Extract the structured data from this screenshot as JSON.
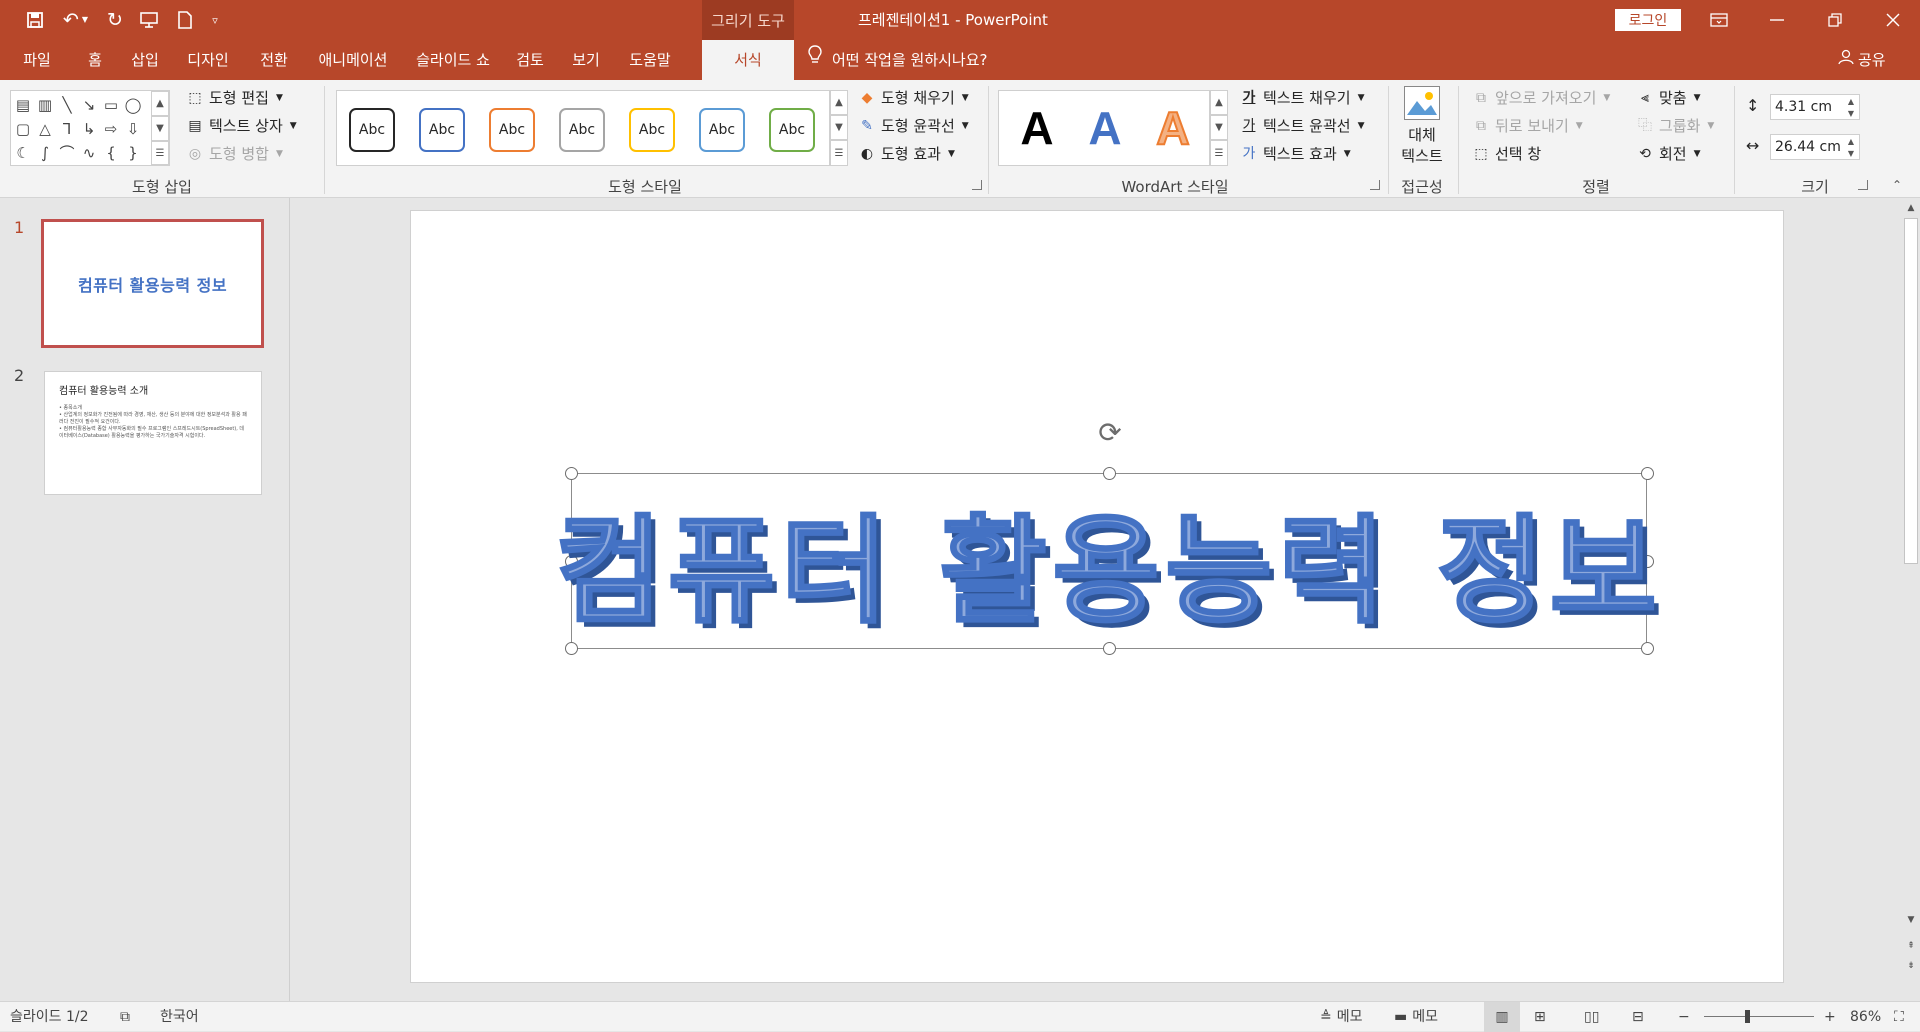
{
  "title_bar": {
    "context_tool": "그리기 도구",
    "document_title": "프레젠테이션1  -  PowerPoint",
    "login_label": "로그인",
    "quick_access_icons": [
      "save-icon",
      "undo-icon",
      "redo-icon",
      "present-icon",
      "new-file-icon",
      "customize-icon"
    ]
  },
  "tabs": [
    {
      "label": "파일"
    },
    {
      "label": "홈"
    },
    {
      "label": "삽입"
    },
    {
      "label": "디자인"
    },
    {
      "label": "전환"
    },
    {
      "label": "애니메이션"
    },
    {
      "label": "슬라이드 쇼"
    },
    {
      "label": "검토"
    },
    {
      "label": "보기"
    },
    {
      "label": "도움말"
    },
    {
      "label": "서식",
      "active": true
    }
  ],
  "tell_me": "어떤 작업을 원하시나요?",
  "share_label": "공유",
  "ribbon": {
    "insert_shapes": {
      "label": "도형 삽입",
      "edit_shape": "도형 편집",
      "text_box": "텍스트 상자",
      "merge_shapes": "도형 병합"
    },
    "shape_styles": {
      "label": "도형 스타일",
      "swatch_text": "Abc",
      "swatch_colors": [
        "#262626",
        "#4472c4",
        "#ed7d31",
        "#a5a5a5",
        "#ffc000",
        "#5b9bd5",
        "#70ad47"
      ],
      "fill": "도형 채우기",
      "outline": "도형 윤곽선",
      "effects": "도형 효과"
    },
    "wordart_styles": {
      "label": "WordArt 스타일",
      "letter": "A",
      "text_fill": "텍스트 채우기",
      "text_outline": "텍스트 윤곽선",
      "text_effects": "텍스트 효과"
    },
    "accessibility": {
      "label": "접근성",
      "alt_text_line1": "대체",
      "alt_text_line2": "텍스트"
    },
    "arrange": {
      "label": "정렬",
      "bring_forward": "앞으로 가져오기",
      "send_backward": "뒤로 보내기",
      "selection_pane": "선택 창",
      "align": "맞춤",
      "group": "그룹화",
      "rotate": "회전"
    },
    "size": {
      "label": "크기",
      "height": "4.31 cm",
      "width": "26.44 cm"
    }
  },
  "slides": [
    {
      "number": "1",
      "title": "컴퓨터 활용능력 정보"
    },
    {
      "number": "2",
      "title": "컴퓨터 활용능력 소개",
      "bullets": [
        "• 종목소개",
        "• 산업계의 정보화가 진전됨에 따라 경영, 재산, 생산 등의 분야에 대한 정보분석과 활용 패러다 전진이 필수적 요건이다.",
        "• 컴퓨터활용능력 종합 사무자동화의 필수 프로그램인 스프레드시트(SpreadSheet), 데이터베이스(Database) 활용능력을 평가하는 국가기술자격 시험이다."
      ]
    }
  ],
  "slide_canvas": {
    "title": "컴퓨터 활용능력 정보"
  },
  "status_bar": {
    "slide_indicator": "슬라이드 1/2",
    "language": "한국어",
    "notes1": "메모",
    "notes2": "메모",
    "zoom": "86%"
  }
}
